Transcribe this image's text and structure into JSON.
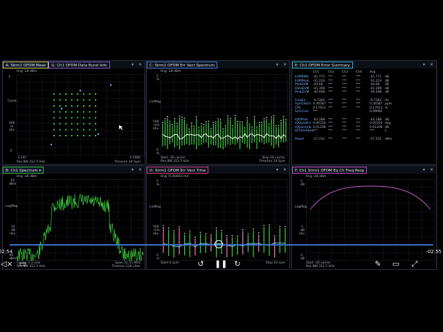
{
  "panes": {
    "a": {
      "tabs": [
        "A: Strm1 OFDM Meas",
        "G: Ch1 OFDM Data Burst Info"
      ],
      "ref": "Rng -28 dBm",
      "ylabels": [
        "2",
        "Const",
        "400",
        "m",
        "/div",
        "-2"
      ],
      "x_left": "-3.197",
      "x_right": "3.1966",
      "foot_left": "Res BW 312.5 kHz",
      "foot_right": "TimeLen 24  Sym"
    },
    "c": {
      "tabs": [
        "C: Strm1 OFDM Err Vect Spectrum"
      ],
      "ref": "Rng -28 dBm",
      "ylabels": [
        "5",
        "%",
        "LinMag",
        "500",
        "m%",
        "/div",
        "0",
        "%"
      ],
      "foot_left1": "Start -26  carrier",
      "foot_left2": "Res BW 312.5 kHz",
      "foot_right1": "Stop 26  carrier",
      "foot_right2": "TimeLen 24  Sym"
    },
    "e": {
      "tabs": [
        "E: Ch1 OFDM Error Summary"
      ],
      "headers": [
        "Ch1",
        "Ch2",
        "Ch3",
        "Ch4",
        "Avg"
      ],
      "rows": [
        {
          "label": "EVMRMS",
          "ch1": "-41.771",
          "ch2": "***",
          "ch3": "***",
          "ch4": "***",
          "avg": "-41.771",
          "unit": "dB"
        },
        {
          "label": "EVMPeak",
          "ch1": "-31.224",
          "ch2": "***",
          "ch3": "***",
          "ch4": "***",
          "avg": "-31.224",
          "unit": "dB"
        },
        {
          "label": "PilotEVM",
          "ch1": "-44.66",
          "ch2": "***",
          "ch3": "***",
          "ch4": "***",
          "avg": "-44.66",
          "unit": "dB"
        },
        {
          "label": "DataEVM",
          "ch1": "-41.399",
          "ch2": "***",
          "ch3": "***",
          "ch4": "***",
          "avg": "-41.399",
          "unit": "dB"
        },
        {
          "label": "PeakEVM",
          "ch1": "-40.008",
          "ch2": "***",
          "ch3": "***",
          "ch4": "***",
          "avg": "-40.008",
          "unit": "dB"
        },
        {
          "label": "",
          "ch1": "",
          "ch2": "",
          "ch3": "",
          "ch4": "",
          "avg": "",
          "unit": ""
        },
        {
          "label": "FreqErr",
          "ch1": "-9.7362",
          "ch2": "***",
          "ch3": "***",
          "ch4": "***",
          "avg": "-9.7362",
          "unit": "Hz"
        },
        {
          "label": "SymClkErr",
          "ch1": "0.36587",
          "ch2": "***",
          "ch3": "***",
          "ch4": "***",
          "avg": "0.36587",
          "unit": "ppm"
        },
        {
          "label": "CPE",
          "ch1": "0.17913",
          "ch2": "***",
          "ch3": "***",
          "ch4": "***",
          "avg": "0.17913",
          "unit": "%"
        },
        {
          "label": "SyncCorr",
          "ch1": "***",
          "ch2": "",
          "ch3": "",
          "ch4": "",
          "avg": "0.99982",
          "unit": ""
        },
        {
          "label": "",
          "ch1": "",
          "ch2": "",
          "ch3": "",
          "ch4": "",
          "avg": "",
          "unit": ""
        },
        {
          "label": "IQOffset",
          "ch1": "-63.188",
          "ch2": "***",
          "ch3": "***",
          "ch4": "***",
          "avg": "-63.188",
          "unit": "dB"
        },
        {
          "label": "IQQuadErr",
          "ch1": "0.00316",
          "ch2": "***",
          "ch3": "***",
          "ch4": "***",
          "avg": "0.00316",
          "unit": "deg"
        },
        {
          "label": "IQGainImb",
          "ch1": "0.01208",
          "ch2": "***",
          "ch3": "***",
          "ch4": "***",
          "avg": "0.01208",
          "unit": "dB"
        },
        {
          "label": "IQTimeSkew",
          "ch1": "***",
          "ch2": "***",
          "ch3": "***",
          "ch4": "***",
          "avg": "***",
          "unit": "s"
        },
        {
          "label": "",
          "ch1": "",
          "ch2": "",
          "ch3": "",
          "ch4": "",
          "avg": "",
          "unit": ""
        },
        {
          "label": "Power",
          "ch1": "-27.231",
          "ch2": "***",
          "ch3": "***",
          "ch4": "***",
          "avg": "-27.231",
          "unit": "dBm"
        }
      ]
    },
    "b": {
      "tabs": [
        "B: Ch1 Spectrum"
      ],
      "ref": "Rng -28 dBm",
      "ylabels": [
        "10",
        "dBm",
        "LogMag",
        "10",
        "dB",
        "/div",
        "-90",
        "dBm"
      ],
      "foot_right1": "Span 31.25 MHz",
      "foot_right2": "TimeLen 126 uSec",
      "foot_left1": "Center 5.1 GHz",
      "foot_left2": "Res BW 312.5 kHz"
    },
    "d": {
      "tabs": [
        "D: Strm1 OFDM Err Vect Time"
      ],
      "ref": "Rng 75.60693 mV",
      "ylabels": [
        "5",
        "%",
        "LinMag",
        "500",
        "m%",
        "/div",
        "0",
        "%"
      ],
      "foot_left": "Start 0   sym",
      "foot_right": "Stop 23   sym"
    },
    "f": {
      "tabs": [
        "F: Ch1 Strm1 OFDM Eq Ch Freq Resp"
      ],
      "ref": "Rng -28 dBm",
      "ylabels": [
        "5",
        "dB",
        "LogMag",
        "1",
        "dB",
        "/div",
        "-5",
        "dB"
      ],
      "foot_left1": "Start -26  carrier",
      "foot_left2": "Res BW 312.5 kHz"
    }
  },
  "player": {
    "elapsed": "02:54",
    "remaining": "-02:55",
    "progress": 0.495
  },
  "colors": {
    "a": "#e6c84a",
    "g": "#8a5fd6",
    "c": "#4c7fe0",
    "e": "#39b9d6",
    "b": "#3cbf3c",
    "d": "#d6408a",
    "f": "#c84ac8",
    "trace": "#3fd23f",
    "accent": "#3d73c9"
  }
}
